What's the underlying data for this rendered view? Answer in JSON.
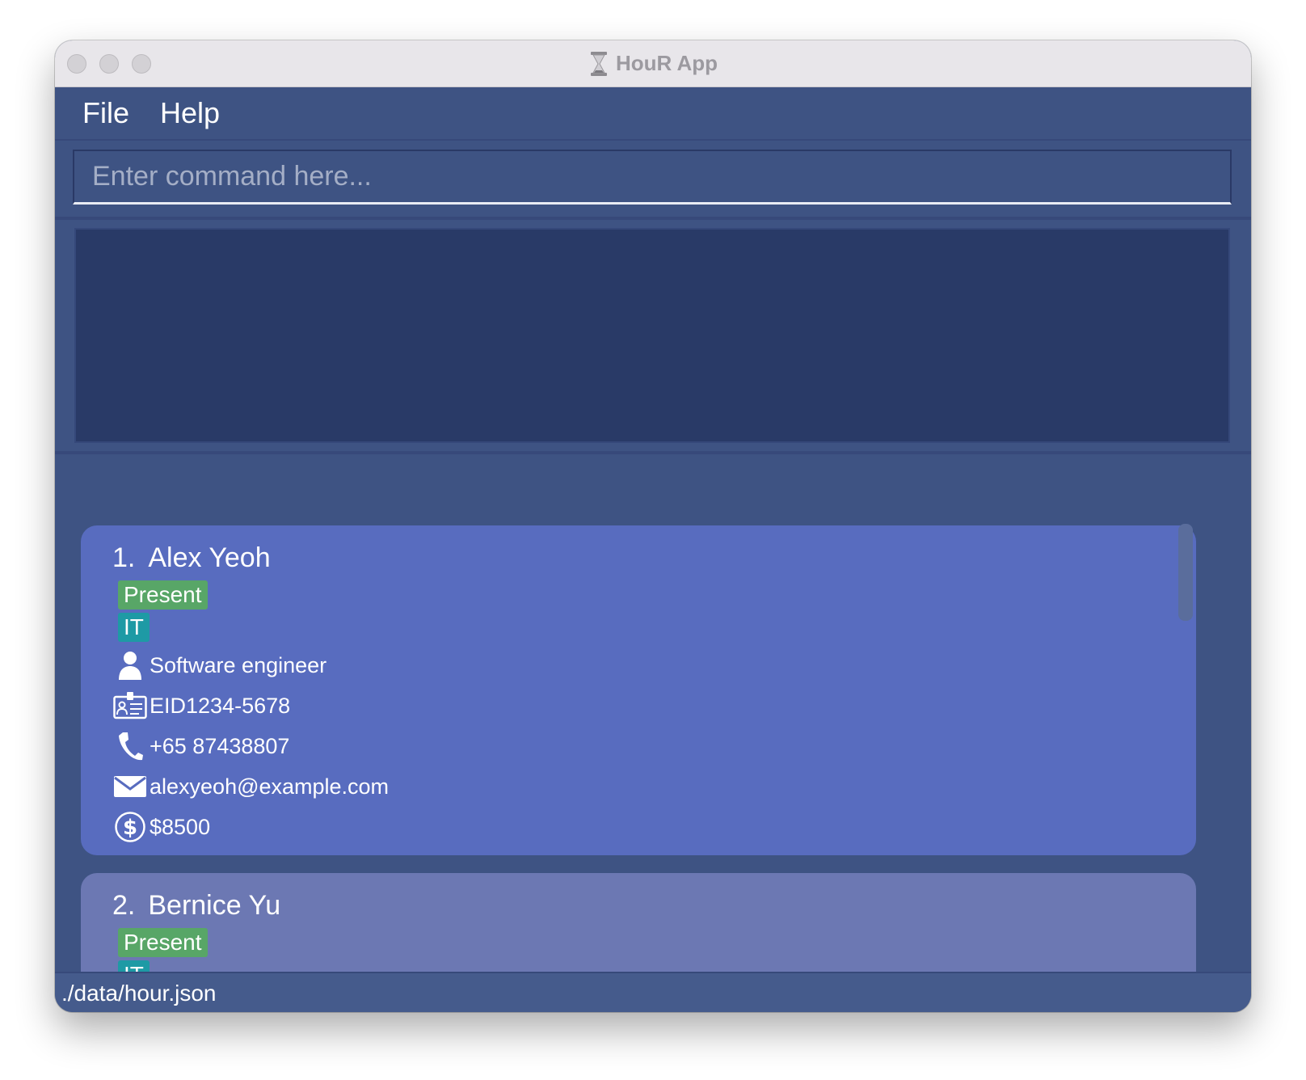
{
  "window": {
    "title": "HouR App"
  },
  "menu": {
    "file": "File",
    "help": "Help"
  },
  "command": {
    "placeholder": "Enter command here...",
    "value": ""
  },
  "result": {
    "text": ""
  },
  "persons": [
    {
      "index": "1.",
      "name": "Alex Yeoh",
      "status": "Present",
      "department": "IT",
      "role": "Software engineer",
      "employee_id": "EID1234-5678",
      "phone": "+65 87438807",
      "email": "alexyeoh@example.com",
      "salary": "$8500",
      "icons": [
        "person-icon",
        "id-card-icon",
        "phone-icon",
        "mail-icon",
        "dollar-icon"
      ]
    },
    {
      "index": "2.",
      "name": "Bernice Yu",
      "status": "Present",
      "department": "IT"
    }
  ],
  "status_bar": {
    "path": "./data/hour.json"
  },
  "colors": {
    "window_bg": "#3e5383",
    "result_bg": "#293a67",
    "card_selected": "#586cbf",
    "card_default": "#6c78b3",
    "tag_status": "#58a667",
    "tag_department": "#1e9aa5"
  }
}
